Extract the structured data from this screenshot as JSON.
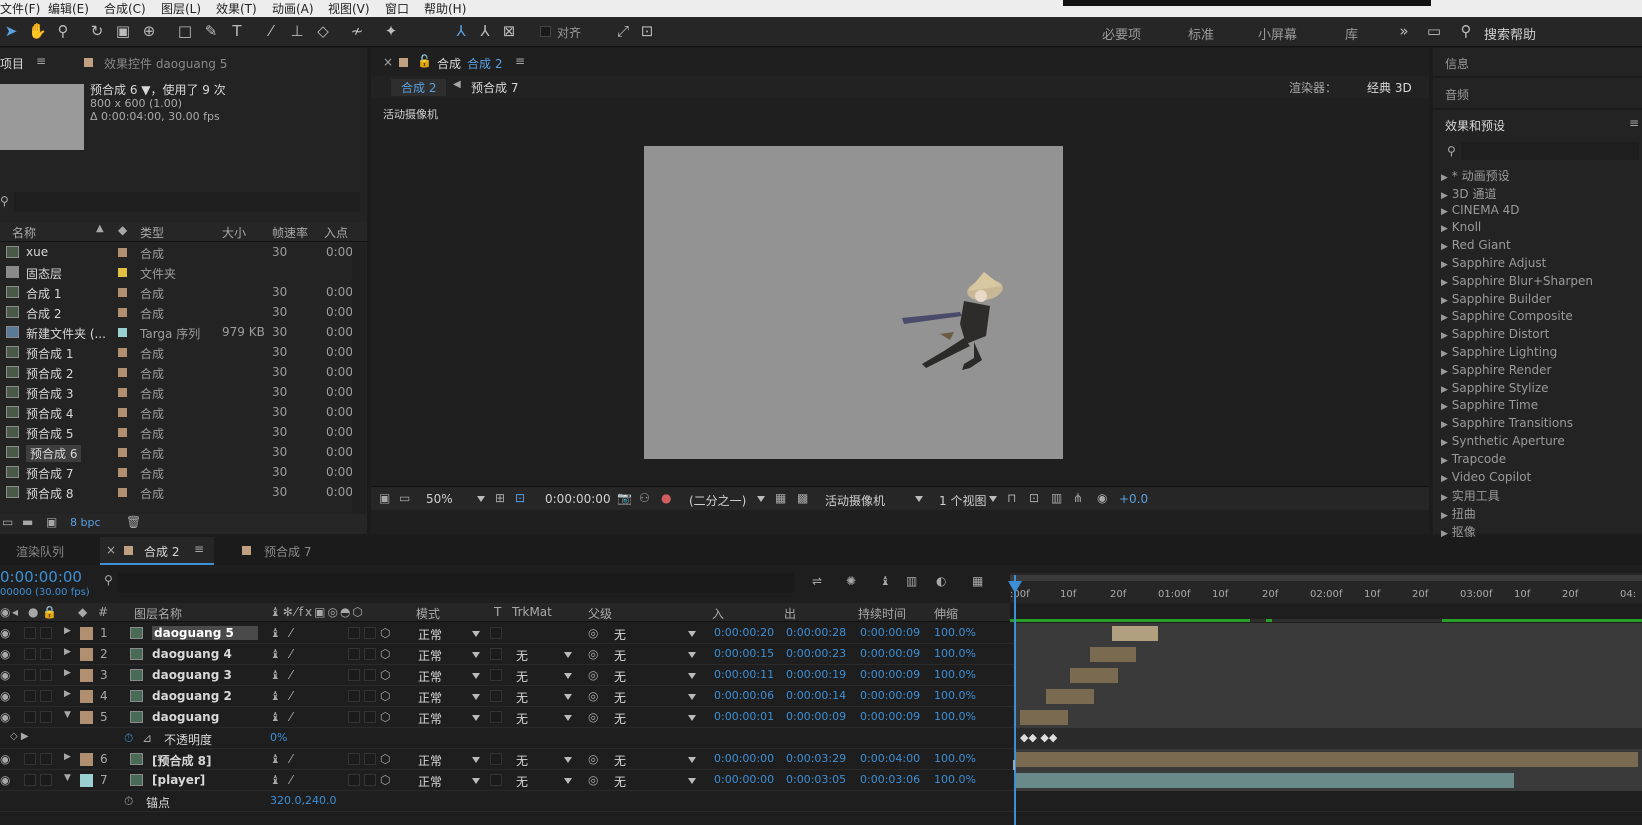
{
  "menu": [
    "文件(F)",
    "编辑(E)",
    "合成(C)",
    "图层(L)",
    "效果(T)",
    "动画(A)",
    "视图(V)",
    "窗口",
    "帮助(H)"
  ],
  "toolbar": {
    "snap_label": "对齐",
    "workspaces": [
      "必要项",
      "标准",
      "小屏幕",
      "库"
    ],
    "search_help": "搜索帮助"
  },
  "project": {
    "tab_project": "项目",
    "tab_effects": "效果控件 daoguang 5",
    "selected_name": "预合成 6 ▼，使用了 9 次",
    "selected_size": "800 x 600 (1.00)",
    "selected_duration": "Δ 0:00:04:00, 30.00 fps",
    "columns": {
      "name": "名称",
      "type": "类型",
      "size": "大小",
      "fps": "帧速率",
      "in": "入点"
    },
    "items": [
      {
        "name": "xue",
        "type": "合成",
        "size": "",
        "fps": "30",
        "in": "0:00",
        "color": "#b09070",
        "icon": "comp"
      },
      {
        "name": "固态层",
        "type": "文件夹",
        "size": "",
        "fps": "",
        "in": "",
        "color": "#e0c040",
        "icon": "folder"
      },
      {
        "name": "合成 1",
        "type": "合成",
        "size": "",
        "fps": "30",
        "in": "0:00",
        "color": "#b09070",
        "icon": "comp"
      },
      {
        "name": "合成 2",
        "type": "合成",
        "size": "",
        "fps": "30",
        "in": "0:00",
        "color": "#b09070",
        "icon": "comp"
      },
      {
        "name": "新建文件夹 (...",
        "type": "Targa 序列",
        "size": "979 KB",
        "fps": "30",
        "in": "0:00",
        "color": "#9ad0d0",
        "icon": "seq"
      },
      {
        "name": "预合成 1",
        "type": "合成",
        "size": "",
        "fps": "30",
        "in": "0:00",
        "color": "#b09070",
        "icon": "comp"
      },
      {
        "name": "预合成 2",
        "type": "合成",
        "size": "",
        "fps": "30",
        "in": "0:00",
        "color": "#b09070",
        "icon": "comp"
      },
      {
        "name": "预合成 3",
        "type": "合成",
        "size": "",
        "fps": "30",
        "in": "0:00",
        "color": "#b09070",
        "icon": "comp"
      },
      {
        "name": "预合成 4",
        "type": "合成",
        "size": "",
        "fps": "30",
        "in": "0:00",
        "color": "#b09070",
        "icon": "comp"
      },
      {
        "name": "预合成 5",
        "type": "合成",
        "size": "",
        "fps": "30",
        "in": "0:00",
        "color": "#b09070",
        "icon": "comp"
      },
      {
        "name": "预合成 6",
        "type": "合成",
        "size": "",
        "fps": "30",
        "in": "0:00",
        "color": "#b09070",
        "icon": "comp",
        "selected": true
      },
      {
        "name": "预合成 7",
        "type": "合成",
        "size": "",
        "fps": "30",
        "in": "0:00",
        "color": "#b09070",
        "icon": "comp"
      },
      {
        "name": "预合成 8",
        "type": "合成",
        "size": "",
        "fps": "30",
        "in": "0:00",
        "color": "#b09070",
        "icon": "comp"
      }
    ],
    "bpc": "8 bpc"
  },
  "comp": {
    "tab_title": "合成",
    "tab_name": "合成 2",
    "crumb_current": "合成 2",
    "crumb_next": "预合成 7",
    "renderer_label": "渲染器：",
    "renderer_value": "经典 3D",
    "camera_label": "活动摄像机",
    "zoom": "50%",
    "timecode": "0:00:00:00",
    "resolution": "(二分之一)",
    "view_camera": "活动摄像机",
    "views": "1 个视图",
    "exposure": "+0.0"
  },
  "right": {
    "info": "信息",
    "audio": "音频",
    "effects_title": "效果和预设",
    "effects": [
      "* 动画预设",
      "3D 通道",
      "CINEMA 4D",
      "Knoll",
      "Red Giant",
      "Sapphire Adjust",
      "Sapphire Blur+Sharpen",
      "Sapphire Builder",
      "Sapphire Composite",
      "Sapphire Distort",
      "Sapphire Lighting",
      "Sapphire Render",
      "Sapphire Stylize",
      "Sapphire Time",
      "Sapphire Transitions",
      "Synthetic Aperture",
      "Trapcode",
      "Video Copilot",
      "实用工具",
      "扭曲",
      "抠像"
    ]
  },
  "timeline": {
    "tab_render": "渲染队列",
    "tab_comp2": "合成 2",
    "tab_pre7": "预合成 7",
    "timecode": "0:00:00:00",
    "timecode_sub": "00000 (30.00 fps)",
    "cols": {
      "num": "#",
      "name": "图层名称",
      "mode": "模式",
      "t": "T",
      "trkmat": "TrkMat",
      "parent": "父级",
      "in": "入",
      "out": "出",
      "dur": "持续时间",
      "stretch": "伸缩"
    },
    "ruler": [
      ":00f",
      "10f",
      "20f",
      "01:00f",
      "10f",
      "20f",
      "02:00f",
      "10f",
      "20f",
      "03:00f",
      "10f",
      "20f",
      "04:"
    ],
    "layers": [
      {
        "num": "1",
        "name": "daoguang 5",
        "mode": "正常",
        "trk": "",
        "parent": "无",
        "in": "0:00:00:20",
        "out": "0:00:00:28",
        "dur": "0:00:00:09",
        "stretch": "100.0%",
        "color": "#b09070",
        "expand": "▶"
      },
      {
        "num": "2",
        "name": "daoguang 4",
        "mode": "正常",
        "trk": "无",
        "parent": "无",
        "in": "0:00:00:15",
        "out": "0:00:00:23",
        "dur": "0:00:00:09",
        "stretch": "100.0%",
        "color": "#b09070",
        "expand": "▶"
      },
      {
        "num": "3",
        "name": "daoguang 3",
        "mode": "正常",
        "trk": "无",
        "parent": "无",
        "in": "0:00:00:11",
        "out": "0:00:00:19",
        "dur": "0:00:00:09",
        "stretch": "100.0%",
        "color": "#b09070",
        "expand": "▶"
      },
      {
        "num": "4",
        "name": "daoguang 2",
        "mode": "正常",
        "trk": "无",
        "parent": "无",
        "in": "0:00:00:06",
        "out": "0:00:00:14",
        "dur": "0:00:00:09",
        "stretch": "100.0%",
        "color": "#b09070",
        "expand": "▶"
      },
      {
        "num": "5",
        "name": "daoguang",
        "mode": "正常",
        "trk": "无",
        "parent": "无",
        "in": "0:00:00:01",
        "out": "0:00:00:09",
        "dur": "0:00:00:09",
        "stretch": "100.0%",
        "color": "#b09070",
        "expand": "▼"
      }
    ],
    "opacity_label": "不透明度",
    "opacity_value": "0%",
    "layers2": [
      {
        "num": "6",
        "name": "[预合成 8]",
        "mode": "正常",
        "trk": "无",
        "parent": "无",
        "in": "0:00:00:00",
        "out": "0:00:03:29",
        "dur": "0:00:04:00",
        "stretch": "100.0%",
        "color": "#b09070",
        "expand": "▶"
      },
      {
        "num": "7",
        "name": "[player]",
        "mode": "正常",
        "trk": "无",
        "parent": "无",
        "in": "0:00:00:00",
        "out": "0:00:03:05",
        "dur": "0:00:03:06",
        "stretch": "100.0%",
        "color": "#9ad0d0",
        "expand": "▼"
      }
    ],
    "anchor_label": "锚点",
    "anchor_value": "320.0,240.0"
  }
}
